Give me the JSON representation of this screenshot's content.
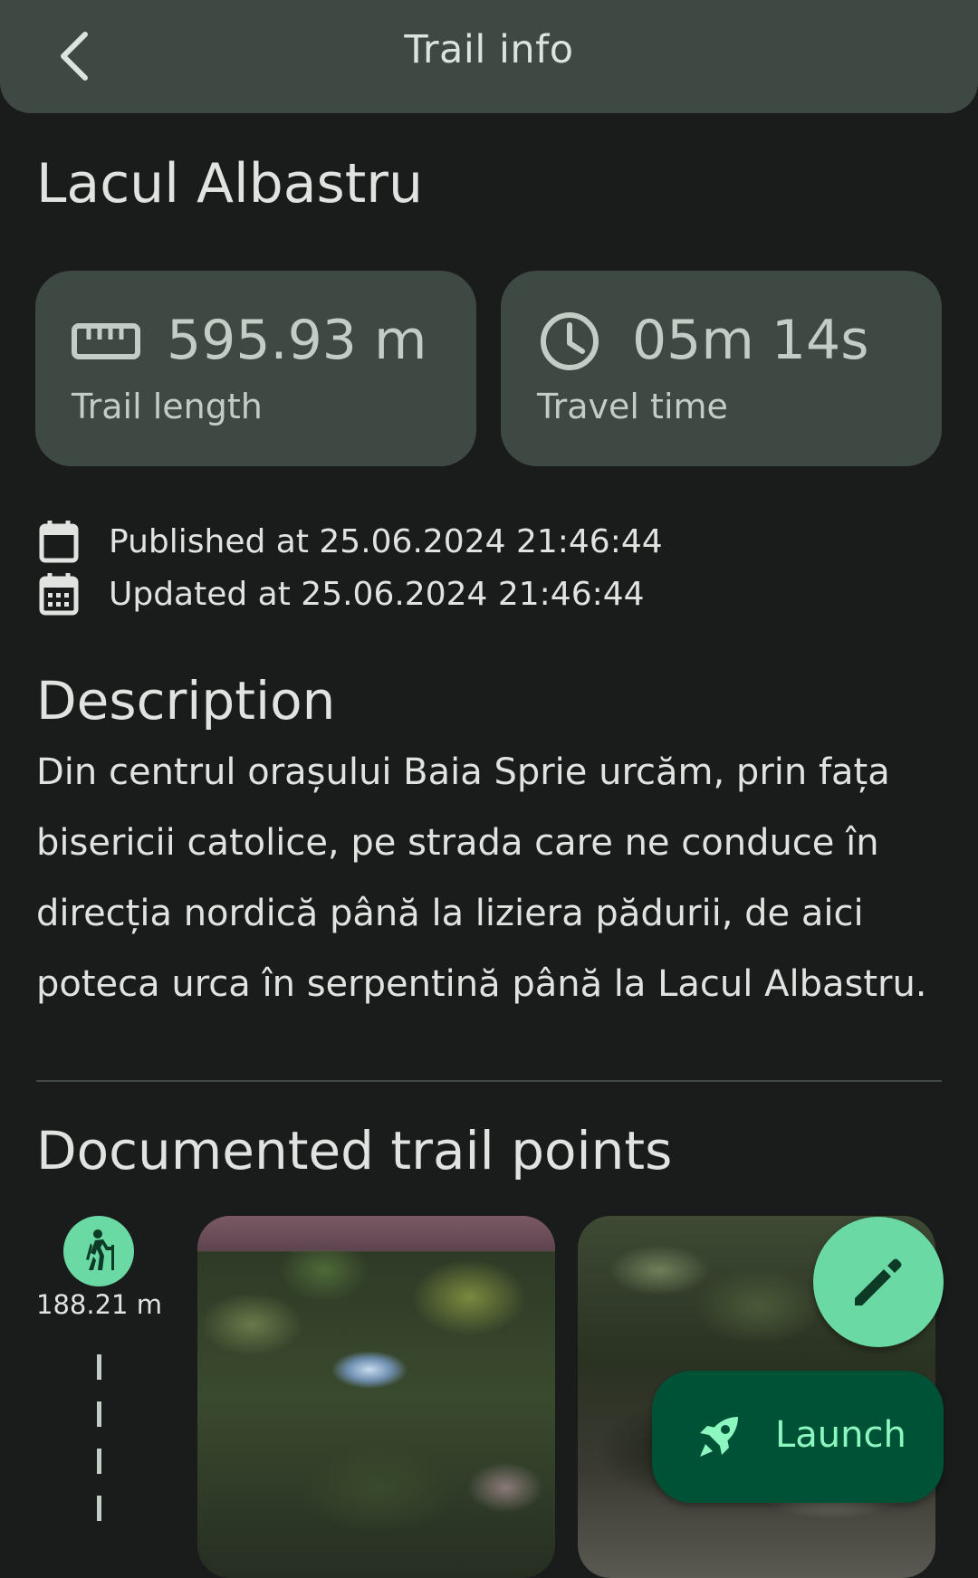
{
  "topbar": {
    "title": "Trail info"
  },
  "trail": {
    "name": "Lacul Albastru"
  },
  "stats": {
    "length": {
      "value": "595.93 m",
      "label": "Trail length"
    },
    "time": {
      "value": "05m 14s",
      "label": "Travel time"
    }
  },
  "meta": {
    "published": "Published at 25.06.2024 21:46:44",
    "updated": "Updated at 25.06.2024 21:46:44"
  },
  "description": {
    "title": "Description",
    "text": "Din centrul orașului Baia Sprie urcăm, prin fața bisericii catolice, pe strada care ne conduce în direcția nordică până la liziera pădurii, de aici poteca urca în serpentină până la Lacul Albastru."
  },
  "points": {
    "title": "Documented trail points",
    "items": [
      {
        "distance": "188.21 m"
      }
    ]
  },
  "fab": {
    "launch_label": "Launch"
  },
  "colors": {
    "background": "#191c1b",
    "surface": "#3f4944",
    "accent": "#6bd9a4",
    "launch_bg": "#005236",
    "launch_fg": "#8cf8bf"
  }
}
